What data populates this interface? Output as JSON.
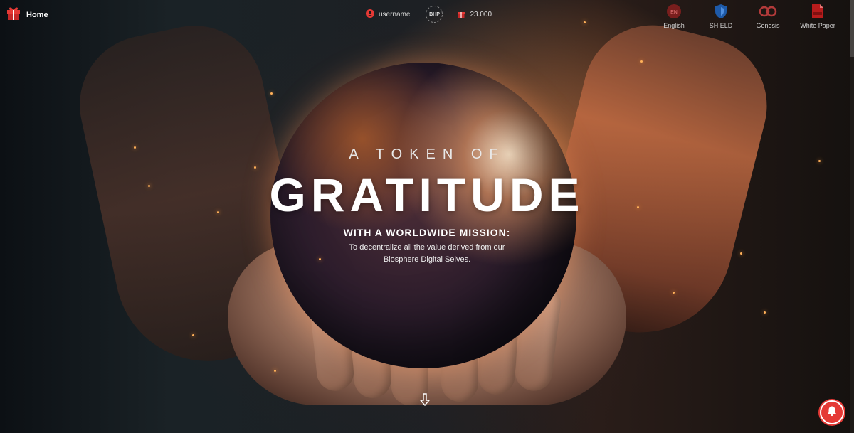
{
  "topbar": {
    "home": {
      "label": "Home",
      "icon": "gift-icon"
    },
    "user": {
      "label": "username",
      "icon": "user-icon"
    },
    "token_badge": "BHP",
    "balance": {
      "value": "23.000",
      "icon": "gift-icon"
    },
    "nav": [
      {
        "label": "English",
        "icon": "language-icon"
      },
      {
        "label": "SHIELD",
        "icon": "shield-icon"
      },
      {
        "label": "Genesis",
        "icon": "infinity-icon"
      },
      {
        "label": "White Paper",
        "icon": "pdf-icon"
      }
    ]
  },
  "hero": {
    "eyebrow": "A TOKEN OF",
    "headline": "GRATITUDE",
    "mission_title": "WITH A WORLDWIDE MISSION:",
    "description_line1": "To decentralize all the value derived from our",
    "description_line2": "Biosphere Digital Selves."
  },
  "controls": {
    "scroll_icon": "arrow-down-icon",
    "notification_icon": "bell-icon"
  },
  "colors": {
    "accent": "#e53935",
    "shield_blue": "#1e5aa8"
  }
}
